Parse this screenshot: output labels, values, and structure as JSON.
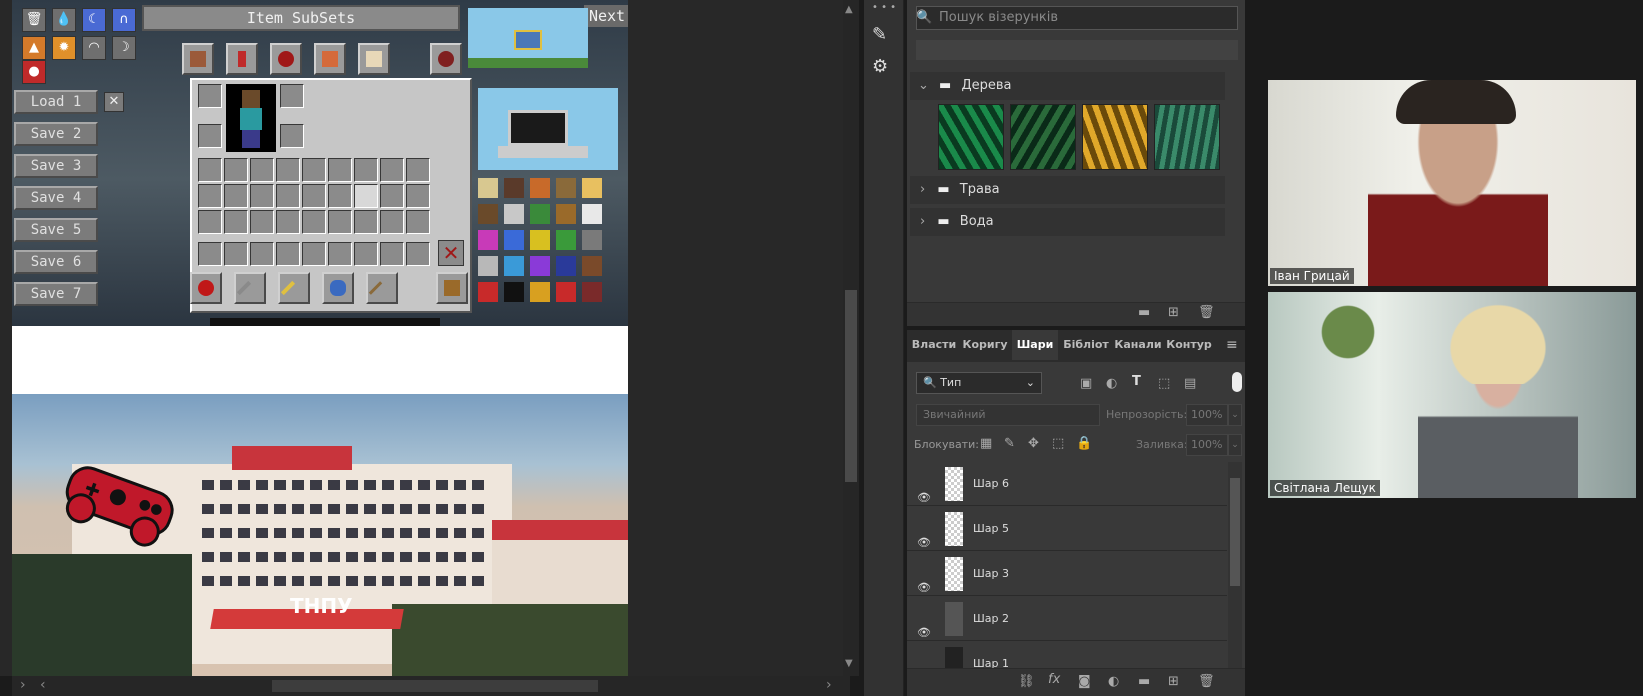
{
  "minecraft": {
    "item_subsets": "Item SubSets",
    "next": "Next",
    "close_x": "✕",
    "load": "Load 1",
    "saves": [
      "Save 2",
      "Save 3",
      "Save 4",
      "Save 5",
      "Save 6",
      "Save 7"
    ]
  },
  "photo": {
    "sign_text": "ТНПУ"
  },
  "patterns": {
    "search_placeholder": "Пошук візерунків",
    "folders": [
      {
        "name": "Дерева",
        "expanded": true
      },
      {
        "name": "Трава",
        "expanded": false
      },
      {
        "name": "Вода",
        "expanded": false
      }
    ],
    "tile_colors": [
      "#0f5a2e",
      "#1e4a2c",
      "#c08a1a",
      "#2f6d52"
    ]
  },
  "layers_panel": {
    "tabs": [
      "Власти",
      "Коригу",
      "Шари",
      "Бібліот",
      "Канали",
      "Контур"
    ],
    "active_tab": "Шари",
    "filter_label": "Тип",
    "blend_mode": "Звичайний",
    "opacity_label": "Непрозорість:",
    "opacity_value": "100%",
    "lock_label": "Блокувати:",
    "fill_label": "Заливка:",
    "fill_value": "100%",
    "layers": [
      "Шар 6",
      "Шар 5",
      "Шар 3",
      "Шар 2",
      "Шар 1"
    ]
  },
  "video": {
    "participants": [
      {
        "name": "Іван Грицай"
      },
      {
        "name": "Світлана Лещук"
      }
    ]
  },
  "colors": {
    "accent": "#4a8ad4",
    "panel": "#393939",
    "gamepad": "#c0182a"
  }
}
